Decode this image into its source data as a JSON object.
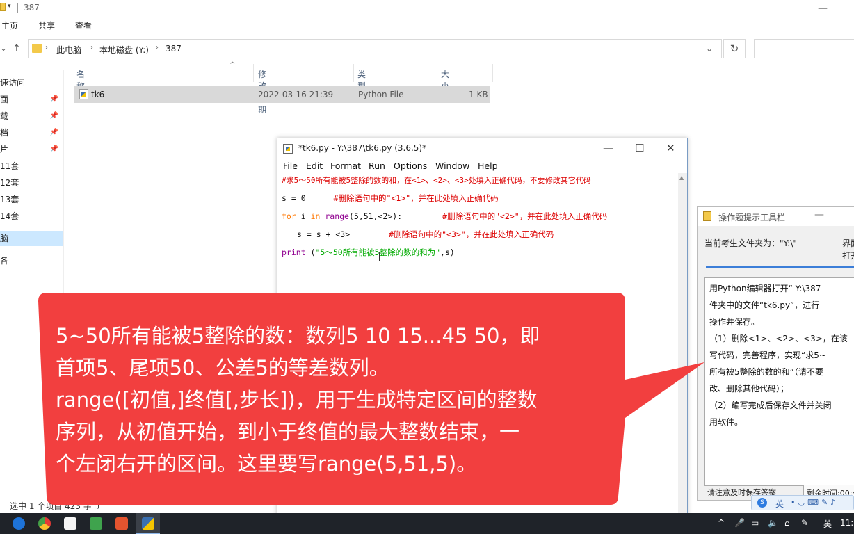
{
  "explorer": {
    "title": "387",
    "ribbon": [
      "主页",
      "共享",
      "查看"
    ],
    "path": [
      "此电脑",
      "本地磁盘 (Y:)",
      "387"
    ],
    "nav_items": [
      {
        "label": "速访问",
        "pinned": false
      },
      {
        "label": "面",
        "pinned": true
      },
      {
        "label": "载",
        "pinned": true
      },
      {
        "label": "档",
        "pinned": true
      },
      {
        "label": "片",
        "pinned": true
      },
      {
        "label": "11套",
        "pinned": false
      },
      {
        "label": "12套",
        "pinned": false
      },
      {
        "label": "13套",
        "pinned": false
      },
      {
        "label": "14套",
        "pinned": false
      },
      {
        "label": "脑",
        "pinned": false,
        "selected": true
      },
      {
        "label": "各",
        "pinned": false
      }
    ],
    "columns": [
      "名称",
      "修改日期",
      "类型",
      "大小"
    ],
    "file": {
      "name": "tk6",
      "date": "2022-03-16 21:39",
      "type": "Python File",
      "size": "1 KB"
    },
    "status": "选中 1 个项目  423 字节"
  },
  "idle": {
    "title": "*tk6.py - Y:\\387\\tk6.py (3.6.5)*",
    "menu": [
      "File",
      "Edit",
      "Format",
      "Run",
      "Options",
      "Window",
      "Help"
    ],
    "code": {
      "line1": "#求5～50所有能被5整除的数的和，在<1>、<2>、<3>处填入正确代码，不要修改其它代码",
      "line2_code": "s = 0",
      "line2_comment": "#删除语句中的\"<1>\"，并在此处填入正确代码",
      "line3_for": "for",
      "line3_i": " i ",
      "line3_in": "in",
      "line3_range": " range",
      "line3_args": "(5,51,<2>):",
      "line3_comment": "#删除语句中的\"<2>\"，并在此处填入正确代码",
      "line4_code": "s = s + <3>",
      "line4_comment": "#删除语句中的\"<3>\"，并在此处填入正确代码",
      "line5_print": "print",
      "line5_open": " (",
      "line5_str": "\"5～50所有能被5整除的数的和为\"",
      "line5_close": ",s)"
    }
  },
  "helper": {
    "title": "操作题提示工具栏",
    "folder_label": "当前考生文件夹为：\"Y:\\\"",
    "right_label": "界面 打开",
    "description": [
      "用Python编辑器打开“ Y:\\387",
      "件夹中的文件“tk6.py”，进行",
      "操作并保存。",
      "（1）删除<1>、<2>、<3>，在该",
      "写代码，完善程序，实现“求5~",
      "所有被5整除的数的和”（请不要",
      "改、删除其他代码）；",
      "（2）编写完成后保存文件并关闭",
      "用软件。"
    ],
    "bottom_left": "请注意及时保存答案",
    "bottom_right": "剩余时间:00:4"
  },
  "ime": {
    "lang": "英",
    "rest": "•◡⌨✎♪"
  },
  "callout": {
    "lines": [
      "5~50所有能被5整除的数：数列5 10 15...45 50，即",
      "首项5、尾项50、公差5的等差数列。",
      "range([初值,]终值[,步长])，用于生成特定区间的整数",
      "序列，从初值开始，到小于终值的最大整数结束，一",
      "个左闭右开的区间。这里要写range(5,51,5)。"
    ],
    "color": "#f23f3f"
  },
  "taskbar": {
    "tray_lang": "英",
    "tray_time": "11:"
  }
}
